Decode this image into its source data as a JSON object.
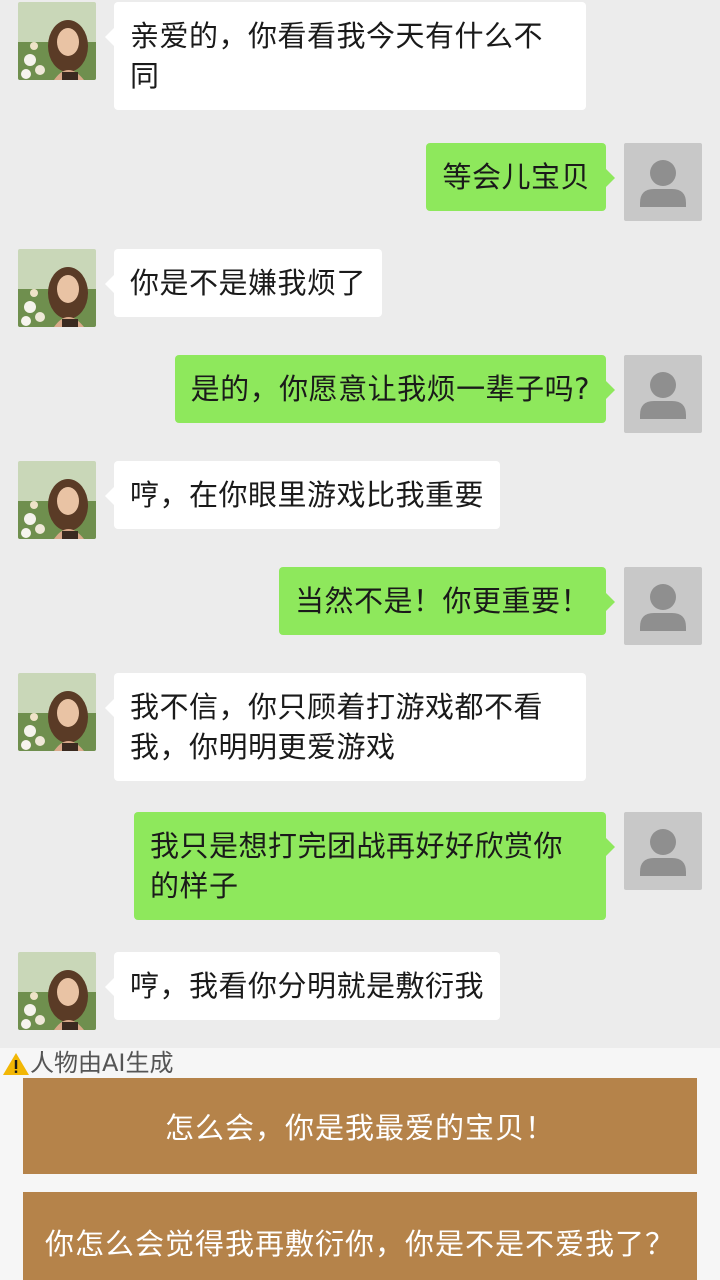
{
  "messages": [
    {
      "sender": "her",
      "text": "亲爱的，你看看我今天有什么不同",
      "lines": [
        "亲爱的，你看看我今天有什么不",
        "同"
      ]
    },
    {
      "sender": "me",
      "text": "等会儿宝贝"
    },
    {
      "sender": "her",
      "text": "你是不是嫌我烦了"
    },
    {
      "sender": "me",
      "text": "是的，你愿意让我烦一辈子吗?"
    },
    {
      "sender": "her",
      "text": "哼，在你眼里游戏比我重要"
    },
    {
      "sender": "me",
      "text": "当然不是！你更重要！"
    },
    {
      "sender": "her",
      "text": "我不信，你只顾着打游戏都不看我，你明明更爱游戏",
      "lines": [
        "我不信，你只顾着打游戏都不看",
        "我，你明明更爱游戏"
      ]
    },
    {
      "sender": "me",
      "text": "我只是想打完团战再好好欣赏你的样子",
      "lines": [
        "我只是想打完团战再好好欣赏你",
        "的样子"
      ]
    },
    {
      "sender": "her",
      "text": "哼，我看你分明就是敷衍我"
    }
  ],
  "ai_notice": "人物由AI生成",
  "choices": [
    {
      "label": "怎么会，你是我最爱的宝贝！"
    },
    {
      "label": "你怎么会觉得我再敷衍你，你是不是不爱我了？"
    }
  ],
  "colors": {
    "background": "#ececec",
    "her_bubble": "#ffffff",
    "my_bubble": "#8ee85c",
    "choice_button": "#b5834a",
    "warning": "#f2b705"
  },
  "icons": {
    "her_avatar": "woman-portrait-avatar",
    "my_avatar": "default-user-avatar",
    "warning": "warning-triangle-icon"
  }
}
